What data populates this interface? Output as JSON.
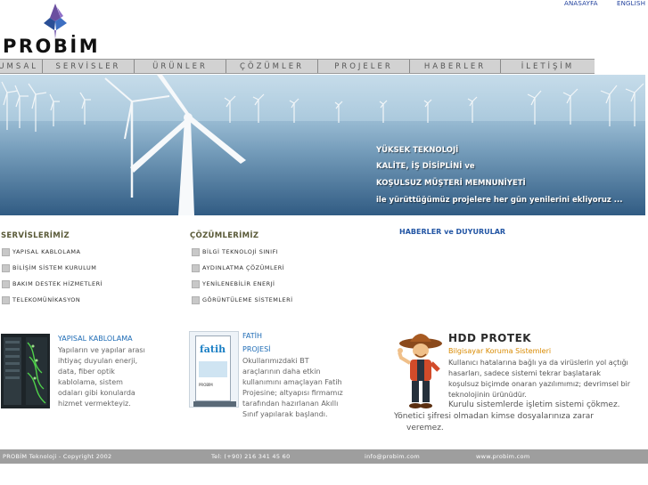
{
  "toplinks": {
    "home": "ANASAYFA",
    "english": "ENGLISH"
  },
  "logo": {
    "text": "PROBİM"
  },
  "nav": {
    "items": [
      "KURUMSAL",
      "SERVİSLER",
      "ÜRÜNLER",
      "ÇÖZÜMLER",
      "PROJELER",
      "HABERLER",
      "İLETİŞİM"
    ]
  },
  "banner": {
    "line1": "YÜKSEK TEKNOLOJİ",
    "line2": "KALİTE,  İŞ DİSİPLİNİ  ve",
    "line3": "KOŞULSUZ MÜŞTERİ MEMNUNİYETİ",
    "line4": "ile yürüttüğümüz projelere her gün yenilerini ekliyoruz ..."
  },
  "services": {
    "heading": "SERVİSLERİMİZ",
    "items": [
      "YAPISAL   KABLOLAMA",
      "BİLİŞİM   SİSTEM   KURULUM",
      "BAKIM   DESTEK   HİZMETLERİ",
      "TELEKOMÜNİKASYON"
    ]
  },
  "solutions": {
    "heading": "ÇÖZÜMLERİMİZ",
    "items": [
      "BİLGİ   TEKNOLOJİ   SINIFI",
      "AYDINLATMA   ÇÖZÜMLERİ",
      "YENİLENEBİLİR   ENERJİ",
      "GÖRÜNTÜLEME   SİSTEMLERİ"
    ]
  },
  "news": {
    "heading": "HABERLER ve DUYURULAR"
  },
  "cabling": {
    "title": "YAPISAL KABLOLAMA",
    "lines": [
      "Yapıların ve yapılar arası",
      "ihtiyaç duyulan enerji,",
      "data, fiber optik",
      "kablolama, sistem",
      "odaları gibi konularda",
      "hizmet vermekteyiz."
    ]
  },
  "fatih": {
    "title1": "FATİH",
    "title2": "PROJESİ",
    "lines": [
      "Okullarımızdaki BT",
      "araçlarının daha etkin",
      "kullanımını amaçlayan Fatih",
      "Projesine; altyapısı firmamız",
      "tarafından hazırlanan Akıllı",
      "Sınıf yapılarak başlandı."
    ],
    "poster_text": "fatih",
    "poster_sub": "PROBİM"
  },
  "hdd": {
    "title": "HDD PROTEK",
    "subtitle": "Bilgisayar Koruma Sistemleri",
    "lines": [
      "Kullanıcı hatalarına bağlı ya da virüslerin yol açtığı",
      "hasarları, sadece sistemi tekrar başlatarak",
      "koşulsuz biçimde onaran yazılımımız; devrimsel bir",
      "teknolojinin ürünüdür."
    ],
    "lines2": [
      "Kurulu sistemlerde işletim sistemi çökmez.",
      "Yönetici şifresi olmadan kimse dosyalarınıza zarar",
      "veremez."
    ]
  },
  "footer": {
    "copyright": "PROBİM Teknoloji - Copyright 2002",
    "tel": "Tel: (+90) 216 341 45 60",
    "email": "info@probim.com",
    "web": "www.probim.com"
  }
}
